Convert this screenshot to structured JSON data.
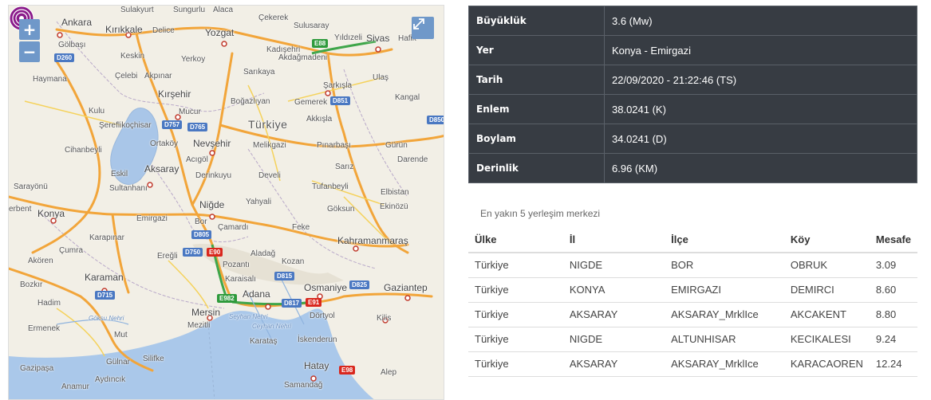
{
  "map": {
    "zoom_in": "+",
    "zoom_out": "−",
    "labels": {
      "sulakyurt": "Sulakyurt",
      "sungurlu": "Sungurlu",
      "alaca": "Alaca",
      "cekerek": "Çekerek",
      "ankara": "Ankara",
      "kirikkale": "Kırıkkale",
      "delice": "Delice",
      "yozgat": "Yozgat",
      "sulusaray": "Sulusaray",
      "yildizeli": "Yıldızeli",
      "sivas": "Sivas",
      "hafik": "Hafik",
      "golbasi": "Gölbaşı",
      "keskin": "Keskin",
      "yerkoy": "Yerkoy",
      "kadisehri": "Kadışehri",
      "akdagmadeni": "Akdağmadeni",
      "celebi": "Çelebi",
      "akpinar": "Akpınar",
      "sarikaya": "Sarıkaya",
      "sarkisla": "Şarkışla",
      "ulas": "Ulaş",
      "haymana": "Haymana",
      "kirsehir": "Kırşehir",
      "bogazliyan": "Boğazlıyan",
      "gemerek": "Gemerek",
      "kangal": "Kangal",
      "kulu": "Kulu",
      "mucur": "Mucur",
      "sereflikochisar": "Şereflikoçhisar",
      "turkiye": "Türkiye",
      "akkisla": "Akkışla",
      "ortakoy": "Ortaköy",
      "nevsehir": "Nevşehir",
      "melikgazi": "Melikgazi",
      "pinarbasi": "Pınarbaşı",
      "gurun": "Gürün",
      "cihanbeyli": "Cihanbeyli",
      "acigol": "Acıgöl",
      "darende": "Darende",
      "eskil": "Eskil",
      "aksaray": "Aksaray",
      "derinkuyu": "Derinkuyu",
      "develi": "Develi",
      "sariz": "Sarız",
      "sarayonu": "Sarayönü",
      "sultanhani": "Sultanhanı",
      "tufanbeyli": "Tufanbeyli",
      "nigde": "Niğde",
      "elbistan": "Elbistan",
      "erbent": "erbent",
      "konya": "Konya",
      "yahyali": "Yahyali",
      "goksun": "Göksun",
      "ekinozu": "Ekinözü",
      "emirgazi": "Emirgazi",
      "bor": "Bor",
      "camardi": "Çamardı",
      "feke": "Feke",
      "karapinar": "Karapınar",
      "kahramanmaras": "Kahramanmaraş",
      "cumra": "Çumra",
      "eregli": "Ereğli",
      "aladag": "Aladağ",
      "akoren": "Akören",
      "pozanti": "Pozantı",
      "kozan": "Kozan",
      "karaman": "Karaman",
      "osmaniye": "Osmaniye",
      "gaziantep": "Gaziantep",
      "bozkir": "Bozkır",
      "karaisali": "Karaisalı",
      "adana": "Adana",
      "hadim": "Hadim",
      "mersin": "Mersin",
      "dortyol": "Dörtyol",
      "kilis": "Kilis",
      "goksu": "Göksu Nehri",
      "seyhan": "Seyhan Nehri",
      "ceyhan": "Ceyhan Nehri",
      "ermenek": "Ermenek",
      "mezitli": "Mezitli",
      "mut": "Mut",
      "karatas": "Karataş",
      "iskenderun": "İskenderun",
      "gulnar": "Gülnar",
      "silifke": "Silifke",
      "hatay": "Hatay",
      "gazipasa": "Gazipaşa",
      "aydincik": "Aydıncık",
      "anamur": "Anamur",
      "aleo": "Alep",
      "samandag": "Samandağ"
    },
    "shields": {
      "d260": "D260",
      "e88": "E88",
      "d851": "D851",
      "d757": "D757",
      "d765": "D765",
      "d850": "D850",
      "d805": "D805",
      "d750": "D750",
      "e90": "E90",
      "e982": "E982",
      "d815": "D815",
      "d825": "D825",
      "d817": "D817",
      "e91": "E91",
      "d715": "D715",
      "e98": "E98"
    }
  },
  "info": [
    {
      "key": "Büyüklük",
      "value": "3.6 (Mw)"
    },
    {
      "key": "Yer",
      "value": "Konya - Emirgazi"
    },
    {
      "key": "Tarih",
      "value": "22/09/2020 - 21:22:46 (TS)"
    },
    {
      "key": "Enlem",
      "value": "38.0241 (K)"
    },
    {
      "key": "Boylam",
      "value": "34.0241 (D)"
    },
    {
      "key": "Derinlik",
      "value": "6.96 (KM)"
    }
  ],
  "nearest_title": "En yakın 5 yerleşim merkezi",
  "settlements": {
    "headers": [
      "Ülke",
      "İl",
      "İlçe",
      "Köy",
      "Mesafe"
    ],
    "rows": [
      [
        "Türkiye",
        "NIGDE",
        "BOR",
        "OBRUK",
        "3.09"
      ],
      [
        "Türkiye",
        "KONYA",
        "EMIRGAZI",
        "DEMIRCI",
        "8.60"
      ],
      [
        "Türkiye",
        "AKSARAY",
        "AKSARAY_MrklIce",
        "AKCAKENT",
        "8.80"
      ],
      [
        "Türkiye",
        "NIGDE",
        "ALTUNHISAR",
        "KECIKALESI",
        "9.24"
      ],
      [
        "Türkiye",
        "AKSARAY",
        "AKSARAY_MrklIce",
        "KARACAOREN",
        "12.24"
      ]
    ]
  }
}
